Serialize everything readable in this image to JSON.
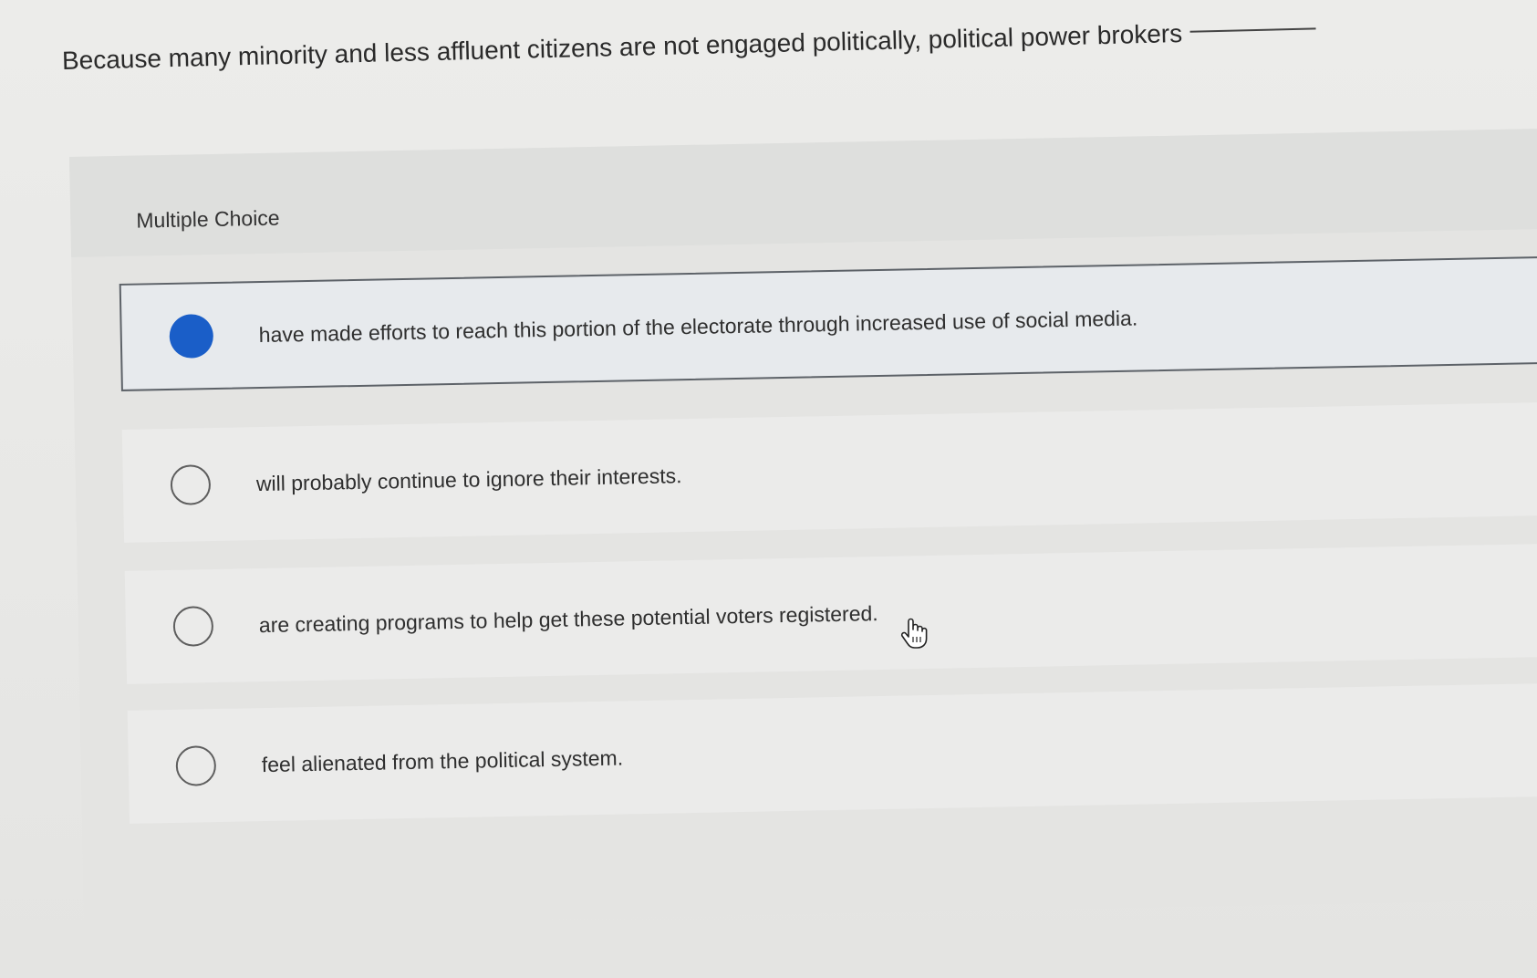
{
  "question": {
    "text": "Because many minority and less affluent citizens are not engaged politically, political power brokers"
  },
  "panel": {
    "type_label": "Multiple Choice"
  },
  "options": [
    {
      "label": "have made efforts to reach this portion of the electorate through increased use of social media.",
      "selected": true
    },
    {
      "label": "will probably continue to ignore their interests.",
      "selected": false
    },
    {
      "label": "are creating programs to help get these potential voters registered.",
      "selected": false
    },
    {
      "label": "feel alienated from the political system.",
      "selected": false
    }
  ],
  "colors": {
    "selected_radio": "#1a5ec8",
    "selected_border": "#5d6268"
  },
  "icons": {
    "cursor": "hand-pointer-icon"
  }
}
